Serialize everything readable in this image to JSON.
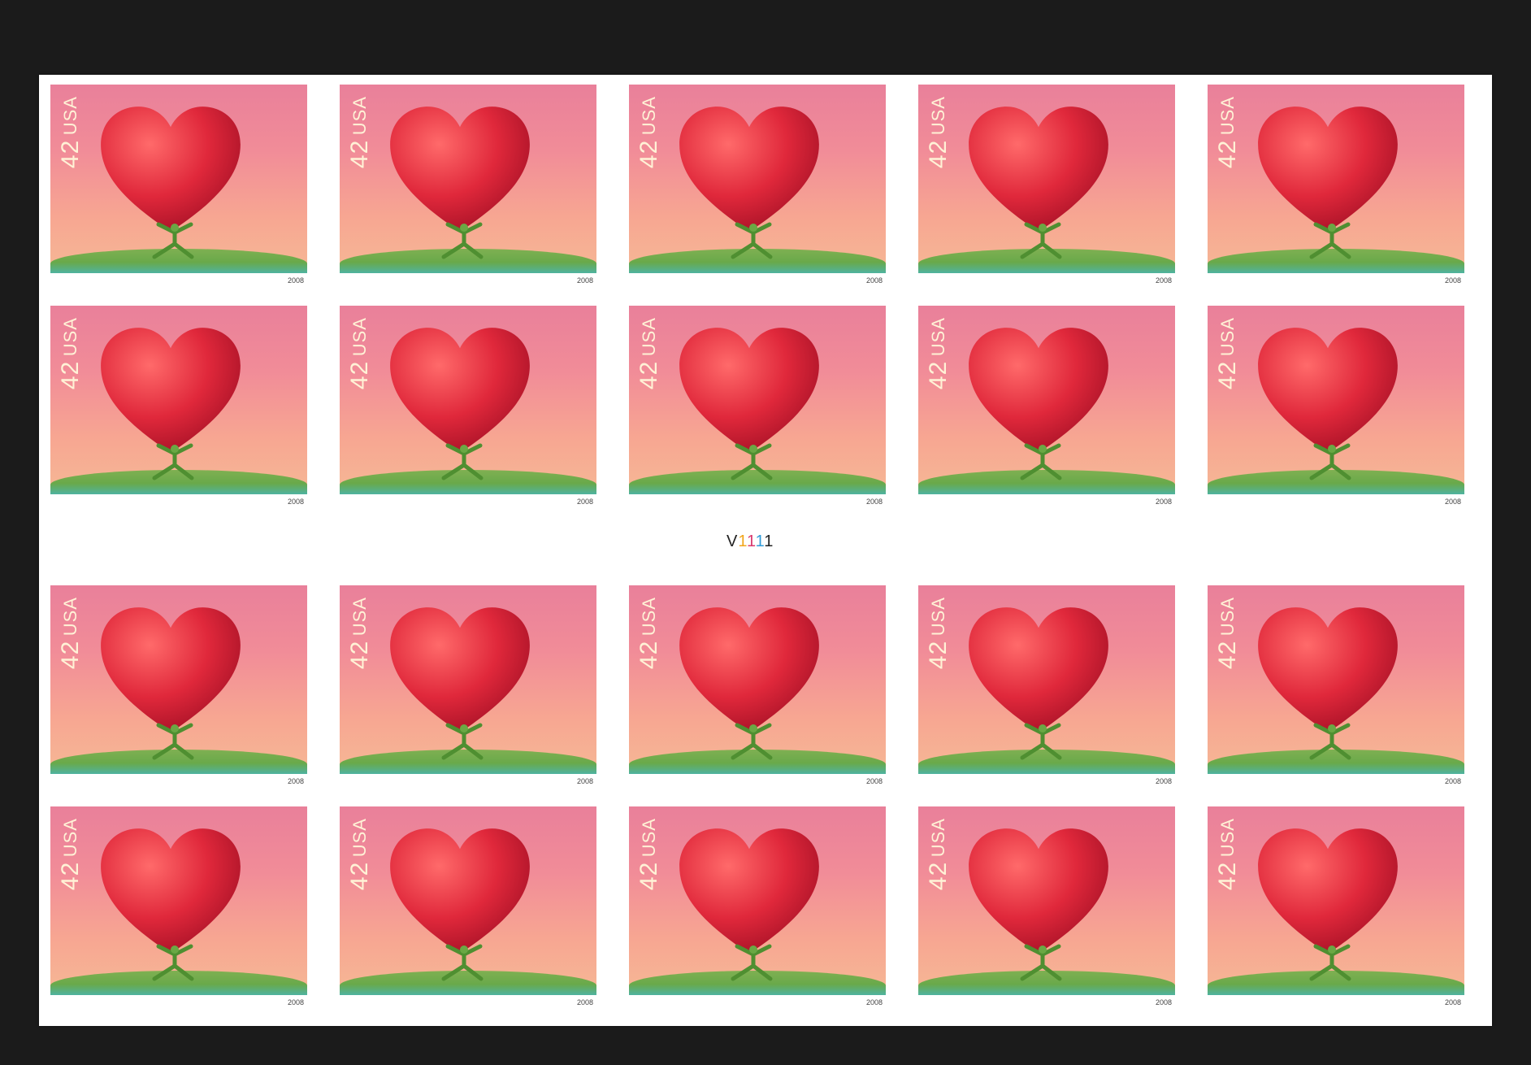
{
  "sheet": {
    "plate_number": {
      "prefix": "V",
      "digits": [
        "1",
        "1",
        "1",
        "1"
      ]
    },
    "stamp": {
      "denomination": "42",
      "country": "USA",
      "year": "2008",
      "colors": {
        "sky_top": "#e9809a",
        "sky_bottom": "#f6b895",
        "heart": "#e0283b",
        "ground": "#7fb052",
        "figure": "#5a9c3a"
      }
    },
    "rows": 4,
    "columns": 5,
    "total_stamps": 20,
    "icon": "heart-carrying-figure"
  }
}
